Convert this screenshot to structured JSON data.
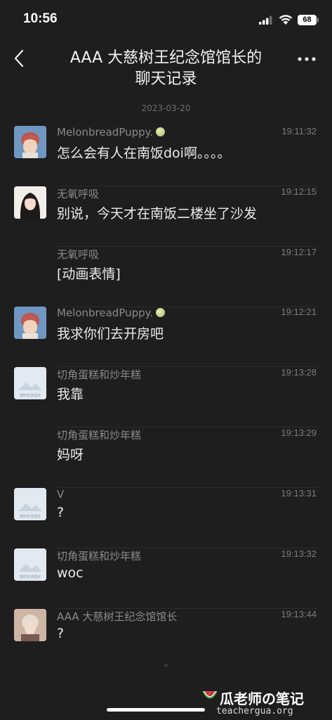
{
  "status_bar": {
    "time": "10:56",
    "battery": "68"
  },
  "header": {
    "title_line1": "AAA 大慈树王纪念馆馆长的",
    "title_line2": "聊天记录"
  },
  "date_separator": "2023-03-20",
  "messages": [
    {
      "sender": "MelonbreadPuppy.",
      "time": "19:11:32",
      "text": "怎么会有人在南饭doi啊。。。。",
      "avatar": "melon"
    },
    {
      "sender": "无氧呼吸",
      "time": "19:12:15",
      "text": "别说，今天才在南饭二楼坐了沙发",
      "avatar": "girl"
    },
    {
      "sender": "无氧呼吸",
      "time": "19:12:17",
      "text": "[动画表情]",
      "avatar": "none"
    },
    {
      "sender": "MelonbreadPuppy.",
      "time": "19:12:21",
      "text": "我求你们去开房吧",
      "avatar": "melon"
    },
    {
      "sender": "切角蛋糕和炒年糕",
      "time": "19:13:28",
      "text": "我靠",
      "avatar": "placeholder"
    },
    {
      "sender": "切角蛋糕和炒年糕",
      "time": "19:13:29",
      "text": "妈呀",
      "avatar": "none"
    },
    {
      "sender": "V",
      "time": "19:13:31",
      "text": "?",
      "avatar": "placeholder"
    },
    {
      "sender": "切角蛋糕和炒年糕",
      "time": "19:13:32",
      "text": "woc",
      "avatar": "placeholder"
    },
    {
      "sender": "AAA 大慈树王纪念馆馆长",
      "time": "19:13:44",
      "text": "?",
      "avatar": "aaa"
    }
  ],
  "placeholder_avatar_caption": "暂时无法显示",
  "watermark": {
    "title": "瓜老师の笔记",
    "url": "teachergua.org"
  }
}
